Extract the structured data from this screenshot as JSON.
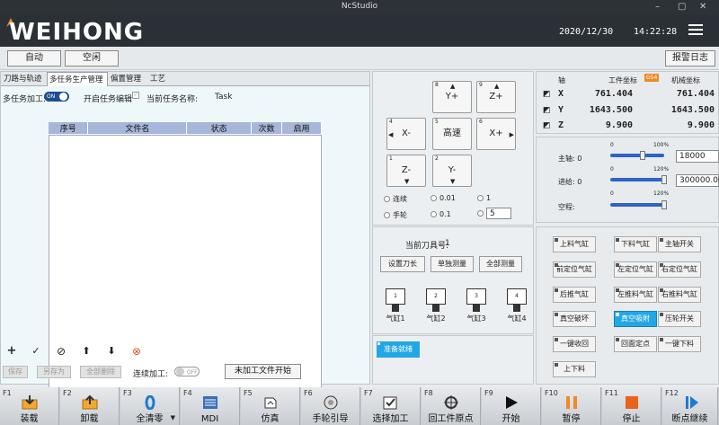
{
  "window": {
    "title": "NcStudio",
    "controls": [
      "–",
      "▢",
      "✕"
    ]
  },
  "header": {
    "brand": "WEIHONG",
    "date": "2020/12/30",
    "time": "14:22:28"
  },
  "status": {
    "mode": "自动",
    "state": "空闲",
    "alarm_log": "报警日志"
  },
  "left": {
    "tabs": [
      "刀路与轨迹",
      "多任务生产管理",
      "偏置管理",
      "工艺"
    ],
    "active_tab": 1,
    "multitask_label": "多任务加工:",
    "multitask_toggle": "ON",
    "enable_edit_label": "开启任务编辑",
    "current_task_label": "当前任务名称:",
    "current_task_value": "Task",
    "columns": [
      "序号",
      "文件名",
      "状态",
      "次数",
      "启用"
    ],
    "rows": [],
    "save": "保存",
    "save_as": "另存为",
    "delete_all": "全部删除",
    "continuous_label": "连续加工:",
    "continuous_toggle": "OFF",
    "start_unprocessed": "未加工文件开始"
  },
  "jog": {
    "buttons": [
      {
        "num": "8",
        "label": "Y+"
      },
      {
        "num": "9",
        "label": "Z+"
      },
      {
        "num": "4",
        "label": "X-"
      },
      {
        "num": "5",
        "label": "高速"
      },
      {
        "num": "6",
        "label": "X+"
      },
      {
        "num": "1",
        "label": "Z-"
      },
      {
        "num": "2",
        "label": "Y-"
      }
    ],
    "modes": [
      "连续",
      "手轮"
    ],
    "steps": [
      "0.01",
      "0.1",
      "1"
    ],
    "custom_step": "5"
  },
  "tool": {
    "current_label": "当前刀具号:",
    "current_value": "1",
    "set_length": "设置刀长",
    "single_measure": "单独测量",
    "all_measure": "全部测量",
    "cylinders": [
      {
        "num": "1",
        "label": "气缸1"
      },
      {
        "num": "2",
        "label": "气缸2"
      },
      {
        "num": "3",
        "label": "气缸3"
      },
      {
        "num": "4",
        "label": "气缸4"
      }
    ],
    "prepare": "准备就绪"
  },
  "coords": {
    "axis_header": "轴",
    "work_header": "工件坐标",
    "work_badge": "G54",
    "machine_header": "机械坐标",
    "axes": [
      {
        "name": "X",
        "work": "761.404",
        "machine": "761.404"
      },
      {
        "name": "Y",
        "work": "1643.500",
        "machine": "1643.500"
      },
      {
        "name": "Z",
        "work": "9.900",
        "machine": "9.900"
      }
    ]
  },
  "spindle": {
    "spindle_label": "主轴: 0",
    "spindle_min": "0",
    "spindle_max": "100%",
    "spindle_level": 0.6,
    "spindle_value": "18000",
    "feed_label": "进给: 0",
    "feed_min": "0",
    "feed_max": "120%",
    "feed_level": 1.0,
    "feed_value": "300000.000",
    "idle_label": "空程:",
    "idle_min": "0",
    "idle_max": "120%",
    "idle_level": 1.0
  },
  "io": {
    "buttons": [
      {
        "label": "上料气缸",
        "on": false
      },
      {
        "label": "下料气缸",
        "on": false
      },
      {
        "label": "主轴开关",
        "on": false
      },
      {
        "label": "前定位气缸",
        "on": false
      },
      {
        "label": "左定位气缸",
        "on": false
      },
      {
        "label": "右定位气缸",
        "on": false
      },
      {
        "label": "后推气缸",
        "on": false
      },
      {
        "label": "左推料气缸",
        "on": false
      },
      {
        "label": "右推料气缸",
        "on": false
      },
      {
        "label": "真空破坏",
        "on": false
      },
      {
        "label": "真空吸附",
        "on": true
      },
      {
        "label": "压轮开关",
        "on": false
      },
      {
        "label": "一键收回",
        "on": false
      },
      {
        "label": "回面定点",
        "on": false
      },
      {
        "label": "一键下料",
        "on": false
      },
      {
        "label": "上下料",
        "on": false
      }
    ]
  },
  "fkeys": [
    {
      "key": "F1",
      "label": "装载",
      "icon": "load-icon"
    },
    {
      "key": "F2",
      "label": "卸载",
      "icon": "unload-icon"
    },
    {
      "key": "F3",
      "label": "全清零",
      "icon": "zero-icon"
    },
    {
      "key": "F4",
      "label": "MDI",
      "icon": "mdi-icon"
    },
    {
      "key": "F5",
      "label": "仿真",
      "icon": "simulate-icon"
    },
    {
      "key": "F6",
      "label": "手轮引导",
      "icon": "handwheel-icon"
    },
    {
      "key": "F7",
      "label": "选择加工",
      "icon": "select-process-icon"
    },
    {
      "key": "F8",
      "label": "回工件原点",
      "icon": "origin-icon"
    },
    {
      "key": "F9",
      "label": "开始",
      "icon": "play-icon"
    },
    {
      "key": "F10",
      "label": "暂停",
      "icon": "pause-icon"
    },
    {
      "key": "F11",
      "label": "停止",
      "icon": "stop-icon"
    },
    {
      "key": "F12",
      "label": "断点继续",
      "icon": "resume-icon"
    }
  ],
  "colors": {
    "accent": "#22a7e6",
    "brand_orange": "#f08a24",
    "header": "#2b3036"
  }
}
